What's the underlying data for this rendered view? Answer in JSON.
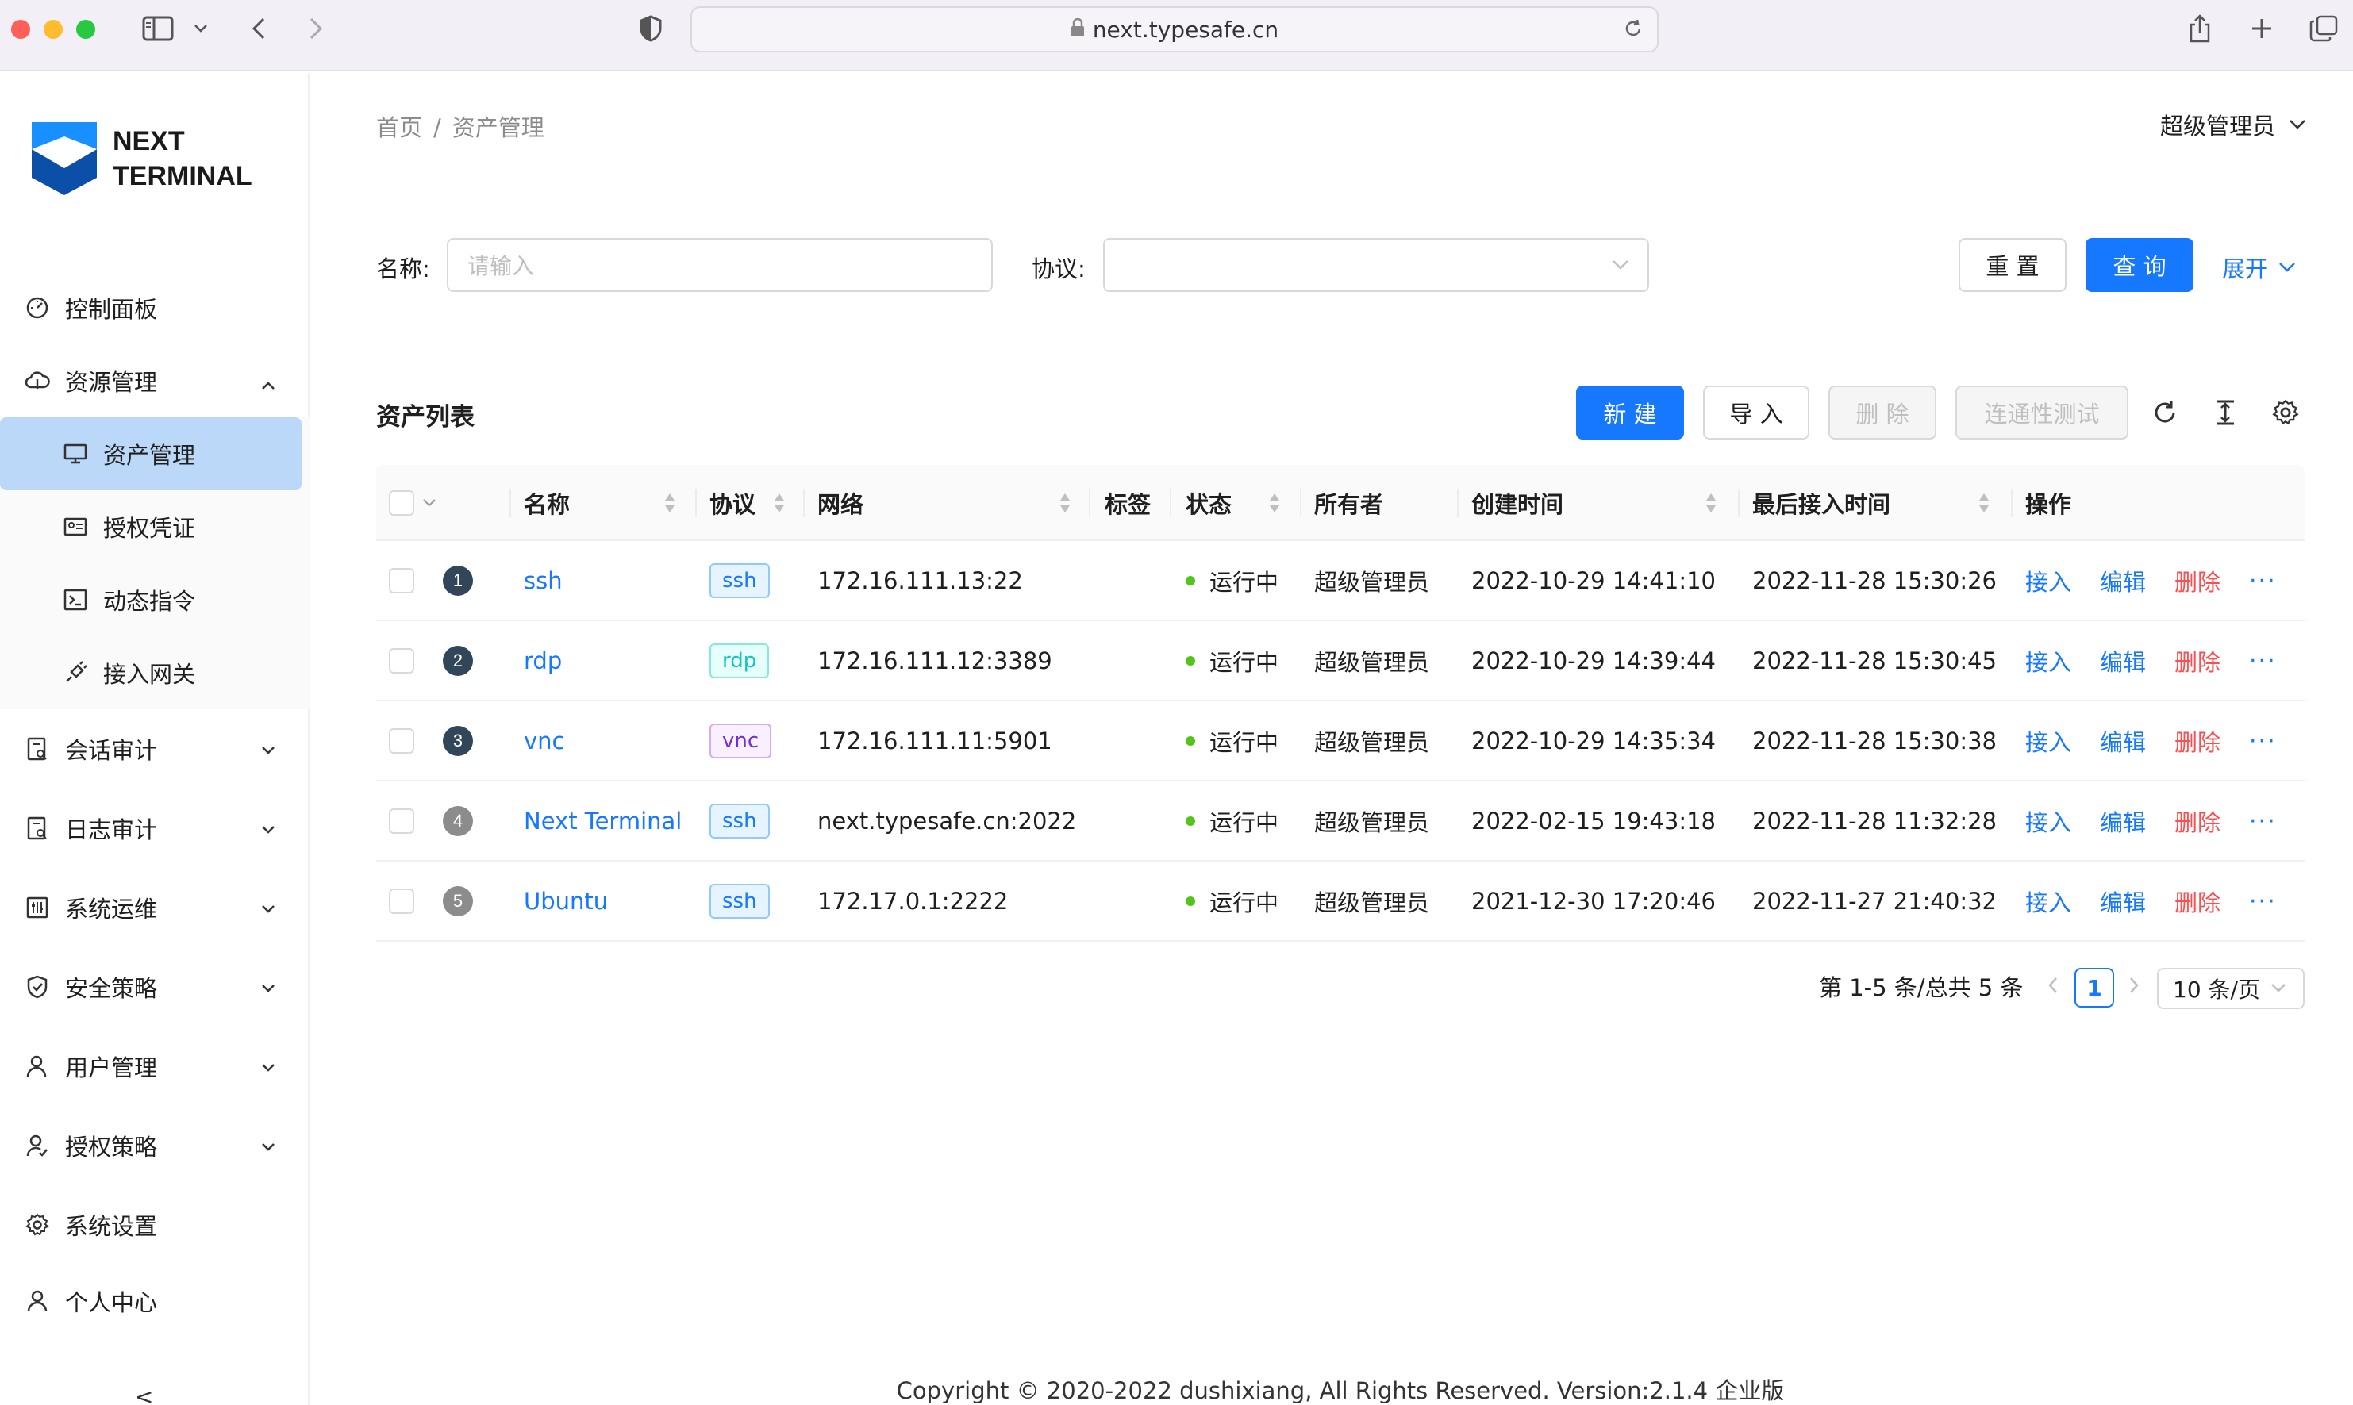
{
  "browser": {
    "url": "next.typesafe.cn"
  },
  "logo": {
    "line1": "NEXT",
    "line2": "TERMINAL"
  },
  "sidebar": {
    "items": [
      {
        "label": "控制面板"
      },
      {
        "label": "资源管理"
      },
      {
        "label": "资产管理"
      },
      {
        "label": "授权凭证"
      },
      {
        "label": "动态指令"
      },
      {
        "label": "接入网关"
      },
      {
        "label": "会话审计"
      },
      {
        "label": "日志审计"
      },
      {
        "label": "系统运维"
      },
      {
        "label": "安全策略"
      },
      {
        "label": "用户管理"
      },
      {
        "label": "授权策略"
      },
      {
        "label": "系统设置"
      },
      {
        "label": "个人中心"
      }
    ],
    "collapse": "<"
  },
  "breadcrumb": {
    "home": "首页",
    "sep": "/",
    "current": "资产管理"
  },
  "user": {
    "name": "超级管理员"
  },
  "filter": {
    "name_label": "名称:",
    "name_placeholder": "请输入",
    "protocol_label": "协议:",
    "reset": "重 置",
    "query": "查 询",
    "expand": "展开"
  },
  "list": {
    "title": "资产列表",
    "new": "新 建",
    "import": "导 入",
    "delete": "删 除",
    "test": "连通性测试"
  },
  "table": {
    "headers": {
      "name": "名称",
      "protocol": "协议",
      "network": "网络",
      "tags": "标签",
      "status": "状态",
      "owner": "所有者",
      "created": "创建时间",
      "last_access": "最后接入时间",
      "actions": "操作"
    },
    "rows": [
      {
        "index": "1",
        "name": "ssh",
        "protocol": "ssh",
        "network": "172.16.111.13:22",
        "status": "运行中",
        "owner": "超级管理员",
        "created": "2022-10-29 14:41:10",
        "last_access": "2022-11-28 15:30:26"
      },
      {
        "index": "2",
        "name": "rdp",
        "protocol": "rdp",
        "network": "172.16.111.12:3389",
        "status": "运行中",
        "owner": "超级管理员",
        "created": "2022-10-29 14:39:44",
        "last_access": "2022-11-28 15:30:45"
      },
      {
        "index": "3",
        "name": "vnc",
        "protocol": "vnc",
        "network": "172.16.111.11:5901",
        "status": "运行中",
        "owner": "超级管理员",
        "created": "2022-10-29 14:35:34",
        "last_access": "2022-11-28 15:30:38"
      },
      {
        "index": "4",
        "name": "Next Terminal",
        "protocol": "ssh",
        "network": "next.typesafe.cn:2022",
        "status": "运行中",
        "owner": "超级管理员",
        "created": "2022-02-15 19:43:18",
        "last_access": "2022-11-28 11:32:28"
      },
      {
        "index": "5",
        "name": "Ubuntu",
        "protocol": "ssh",
        "network": "172.17.0.1:2222",
        "status": "运行中",
        "owner": "超级管理员",
        "created": "2021-12-30 17:20:46",
        "last_access": "2022-11-27 21:40:32"
      }
    ],
    "actions": {
      "connect": "接入",
      "edit": "编辑",
      "delete": "删除",
      "more": "···"
    }
  },
  "pagination": {
    "summary": "第 1-5 条/总共 5 条",
    "page": "1",
    "page_size": "10 条/页"
  },
  "footer": {
    "text": "Copyright © 2020-2022 dushixiang, All Rights Reserved. Version:2.1.4 企业版"
  },
  "colors": {
    "primary": "#1677ff",
    "danger": "#ff4d4f",
    "success": "#52c41a",
    "active_menu": "#bcd8f8",
    "ssh_tag": "#1677ff",
    "rdp_tag": "#13c2c2",
    "vnc_tag": "#722ed1"
  }
}
